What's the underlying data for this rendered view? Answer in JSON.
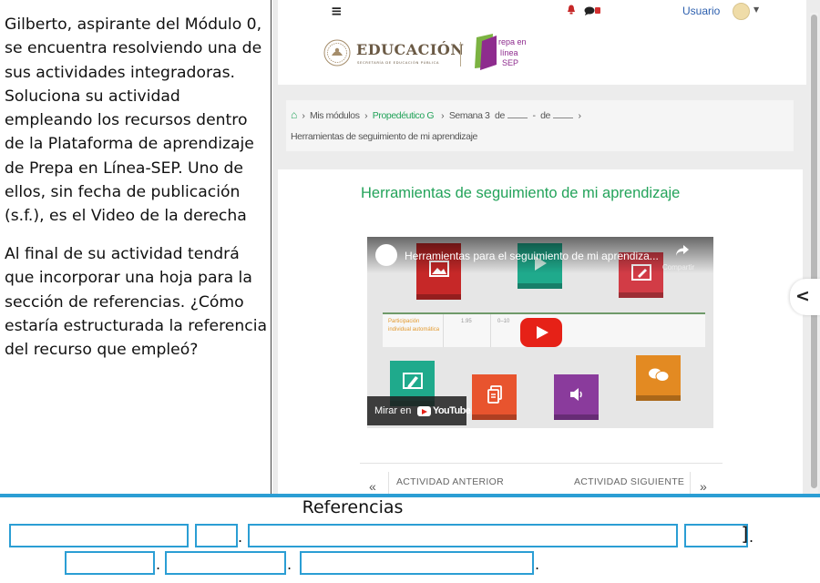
{
  "question": {
    "paragraph1": "Gilberto, aspirante del Módulo 0, se encuentra resolviendo una de sus actividades integradoras. Soluciona su actividad empleando los recursos dentro de la Plataforma de aprendizaje de Prepa en Línea-SEP. Uno de ellos, sin fecha de publicación (s.f.), es el Video de la derecha",
    "paragraph2": "Al final de su actividad tendrá que incorporar una hoja para la sección de referencias. ¿Cómo estaría estructurada la referencia del recurso que empleó?"
  },
  "site": {
    "header": {
      "menu_icon": "≡",
      "user_label": "Usuario",
      "logo_main": "EDUCACIÓN",
      "logo_sub": "SECRETARÍA DE EDUCACIÓN PÚBLICA",
      "prepa_logo_text": "Prepa en Línea SEP"
    },
    "breadcrumb": {
      "items": [
        "Mis módulos",
        "Propedéutico G",
        "Semana 3",
        "de",
        "-",
        "de"
      ],
      "current": "Herramientas de seguimiento de mi aprendizaje"
    },
    "page_title": "Herramientas de seguimiento de mi aprendizaje",
    "video": {
      "title": "Herramientas para el seguimiento de mi aprendiza...",
      "share_label": "Compartir",
      "watch_on": "Mirar en",
      "youtube_label": "YouTube",
      "table_label": "Participación individual automática",
      "table_value_a": "1.95",
      "table_value_b": "0–10"
    },
    "nav": {
      "prev_label": "ACTIVIDAD ANTERIOR",
      "next_label": "ACTIVIDAD SIGUIENTE",
      "prev_arrow": "«",
      "next_arrow": "»"
    }
  },
  "answer": {
    "title": "Referencias",
    "separator": ".",
    "bracket_open": "[",
    "bracket_close": "]"
  },
  "colors": {
    "accent_green": "#23a35a",
    "answer_blue": "#2b9ed4",
    "link_blue": "#2c5fae",
    "youtube_red": "#e62117"
  },
  "icons": [
    "hamburger-menu-icon",
    "bell-icon",
    "chat-icon",
    "avatar",
    "home-icon",
    "share-icon",
    "play-icon",
    "chevron-left-icon"
  ]
}
